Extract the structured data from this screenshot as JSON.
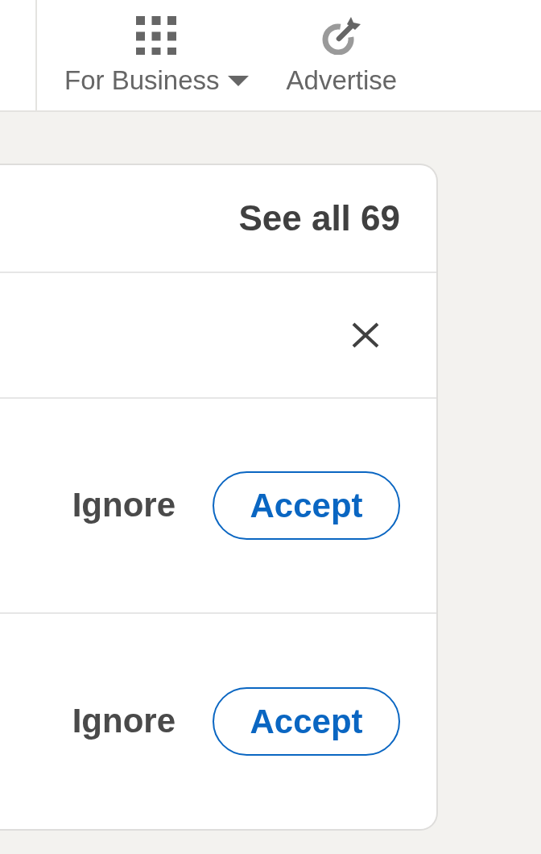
{
  "nav": {
    "items": [
      {
        "label": "For Business",
        "kind": "menu"
      },
      {
        "label": "Advertise",
        "kind": "link"
      }
    ]
  },
  "invitations_card": {
    "header": {
      "see_all": "See all 69"
    },
    "rows": [
      {
        "kind": "dismissible"
      },
      {
        "kind": "invitation",
        "ignore": "Ignore",
        "accept": "Accept"
      },
      {
        "kind": "invitation",
        "ignore": "Ignore",
        "accept": "Accept"
      }
    ]
  }
}
